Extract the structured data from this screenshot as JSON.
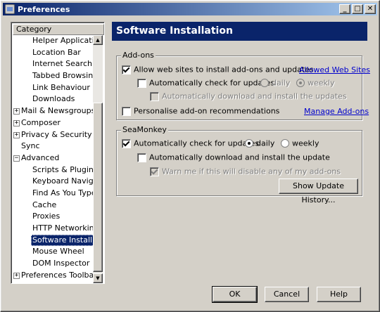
{
  "window": {
    "title": "Preferences",
    "controls": {
      "minimize": "_",
      "maximize": "□",
      "close": "✕"
    }
  },
  "category": {
    "header": "Category",
    "items": [
      {
        "label": "Helper Applicati...",
        "level": 1
      },
      {
        "label": "Location Bar",
        "level": 1
      },
      {
        "label": "Internet Search",
        "level": 1
      },
      {
        "label": "Tabbed Browsing",
        "level": 1
      },
      {
        "label": "Link Behaviour",
        "level": 1
      },
      {
        "label": "Downloads",
        "level": 1
      },
      {
        "label": "Mail & Newsgroups",
        "level": 0,
        "expander": "+"
      },
      {
        "label": "Composer",
        "level": 0,
        "expander": "+"
      },
      {
        "label": "Privacy & Security",
        "level": 0,
        "expander": "+"
      },
      {
        "label": "Sync",
        "level": 0
      },
      {
        "label": "Advanced",
        "level": 0,
        "expander": "−"
      },
      {
        "label": "Scripts & Plugins",
        "level": 1
      },
      {
        "label": "Keyboard Navig...",
        "level": 1
      },
      {
        "label": "Find As You Type",
        "level": 1
      },
      {
        "label": "Cache",
        "level": 1
      },
      {
        "label": "Proxies",
        "level": 1
      },
      {
        "label": "HTTP Networking",
        "level": 1
      },
      {
        "label": "Software Install...",
        "level": 1,
        "selected": true
      },
      {
        "label": "Mouse Wheel",
        "level": 1
      },
      {
        "label": "DOM Inspector",
        "level": 1
      },
      {
        "label": "Preferences Toolbar",
        "level": 0,
        "expander": "+"
      }
    ]
  },
  "panel": {
    "title": "Software Installation",
    "addons": {
      "legend": "Add-ons",
      "allow_label": "Allow web sites to install add-ons and updates",
      "allowed_sites_link": "Allowed Web Sites",
      "auto_check_label": "Automatically check for updates",
      "daily": "daily",
      "weekly": "weekly",
      "auto_download_label": "Automatically download and install the updates",
      "personalise_label": "Personalise add-on recommendations",
      "manage_link": "Manage Add-ons"
    },
    "seamonkey": {
      "legend": "SeaMonkey",
      "auto_check_label": "Automatically check for updates",
      "daily": "daily",
      "weekly": "weekly",
      "auto_download_label": "Automatically download and install the update",
      "warn_label": "Warn me if this will disable any of my add-ons",
      "history_button": "Show Update History..."
    }
  },
  "buttons": {
    "ok": "OK",
    "cancel": "Cancel",
    "help": "Help"
  }
}
